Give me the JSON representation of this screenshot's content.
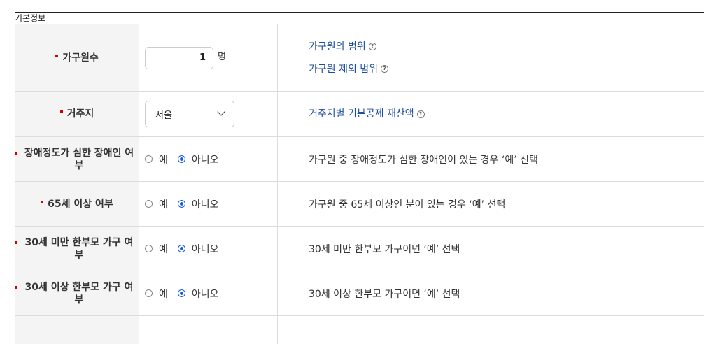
{
  "section": {
    "title": "기본정보"
  },
  "rows": [
    {
      "label": "가구원수",
      "input_value": "1",
      "unit": "명",
      "links": [
        "가구원의 범위",
        "가구원 제외 범위"
      ]
    },
    {
      "label": "거주지",
      "select_value": "서울",
      "links": [
        "거주지별 기본공제 재산액"
      ]
    },
    {
      "label": "장애정도가 심한 장애인 여부",
      "yes": "예",
      "no": "아니오",
      "selected": "아니오",
      "desc": "가구원 중 장애정도가 심한 장애인이 있는 경우 ‘예’ 선택"
    },
    {
      "label": "65세 이상 여부",
      "yes": "예",
      "no": "아니오",
      "selected": "아니오",
      "desc": "가구원 중 65세 이상인 분이 있는 경우 ‘예’ 선택"
    },
    {
      "label": "30세 미만 한부모 가구 여부",
      "yes": "예",
      "no": "아니오",
      "selected": "아니오",
      "desc": "30세 미만 한부모 가구이면 ‘예’ 선택"
    },
    {
      "label": "30세 이상 한부모 가구 여부",
      "yes": "예",
      "no": "아니오",
      "selected": "아니오",
      "desc": "30세 이상 한부모 가구이면 ‘예’ 선택"
    }
  ],
  "icons": {
    "help": "help-circle-icon",
    "required": "required-marker-icon",
    "dropdown": "chevron-down-icon"
  },
  "colors": {
    "required": "#c00000",
    "link": "#1f4e9c",
    "radio_selected": "#1a5fd6",
    "header_bg": "#f4f4f4"
  }
}
